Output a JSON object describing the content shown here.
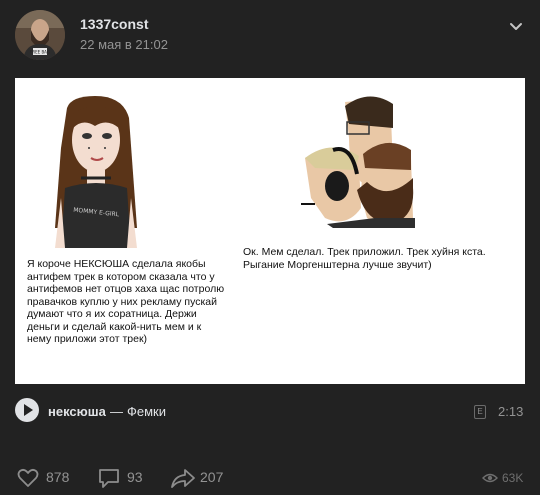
{
  "post": {
    "author": "1337const",
    "date": "22 мая в 21:02"
  },
  "meme": {
    "left_text": "Я короче НЕКСЮША сделала якобы антифем трек в котором сказала что у антифемов нет отцов хаха щас потролю правачков куплю у них рекламу пускай думают что я их соратница. Держи деньги и сделай какой-нить мем и к нему приложи этот трек)",
    "right_text": "Ок. Мем сделал. Трек приложил. Трек хуйня кста. Рыгание Моргенштерна лучше звучит)",
    "shirt_text": "MOMMY E-GIRL",
    "avatar_shirt_text": "FREE BAG"
  },
  "audio": {
    "artist": "нексюша",
    "separator": "—",
    "title": "Фемки",
    "explicit_mark": "E",
    "duration": "2:13"
  },
  "stats": {
    "likes": "878",
    "comments": "93",
    "shares": "207",
    "views": "63K"
  },
  "colors": {
    "background": "#222222",
    "text": "#e1e3e6",
    "secondary": "#939393"
  }
}
